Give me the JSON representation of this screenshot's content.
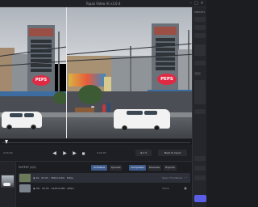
{
  "window": {
    "title": "Topaz Video AI  v3.0.4"
  },
  "viewer": {
    "left_sign": "PEPS",
    "right_sign": "PEPS"
  },
  "transport": {
    "prev_label": "◀",
    "play_label": "▶",
    "next_label": "▶",
    "stop_label": "■",
    "timecode_left": "0:00:00",
    "timecode_right": "0:00:05",
    "zoom_label": "⊕ 1 ▾",
    "back_to_input": "Back to Input"
  },
  "output": {
    "label": "OUTPUT (1/2)",
    "filters": [
      {
        "label": "All Status",
        "active": true
      },
      {
        "label": "Queued",
        "active": false
      },
      {
        "label": "Completed",
        "active": true
      },
      {
        "label": "Previews",
        "active": false
      },
      {
        "label": "Exports",
        "active": false
      }
    ],
    "rows": [
      {
        "info": "◉ 4K  ·  00:05  ·  3840x2160  ·  60fps",
        "size": "Open Thumbnail",
        "selected": true
      },
      {
        "info": "◉ HD  ·  00:05  ·  1920x1080  ·  60fps",
        "size": "30mb",
        "selected": false
      }
    ]
  },
  "right_panel": {
    "header": "PRESETS",
    "export_button": "Export"
  }
}
